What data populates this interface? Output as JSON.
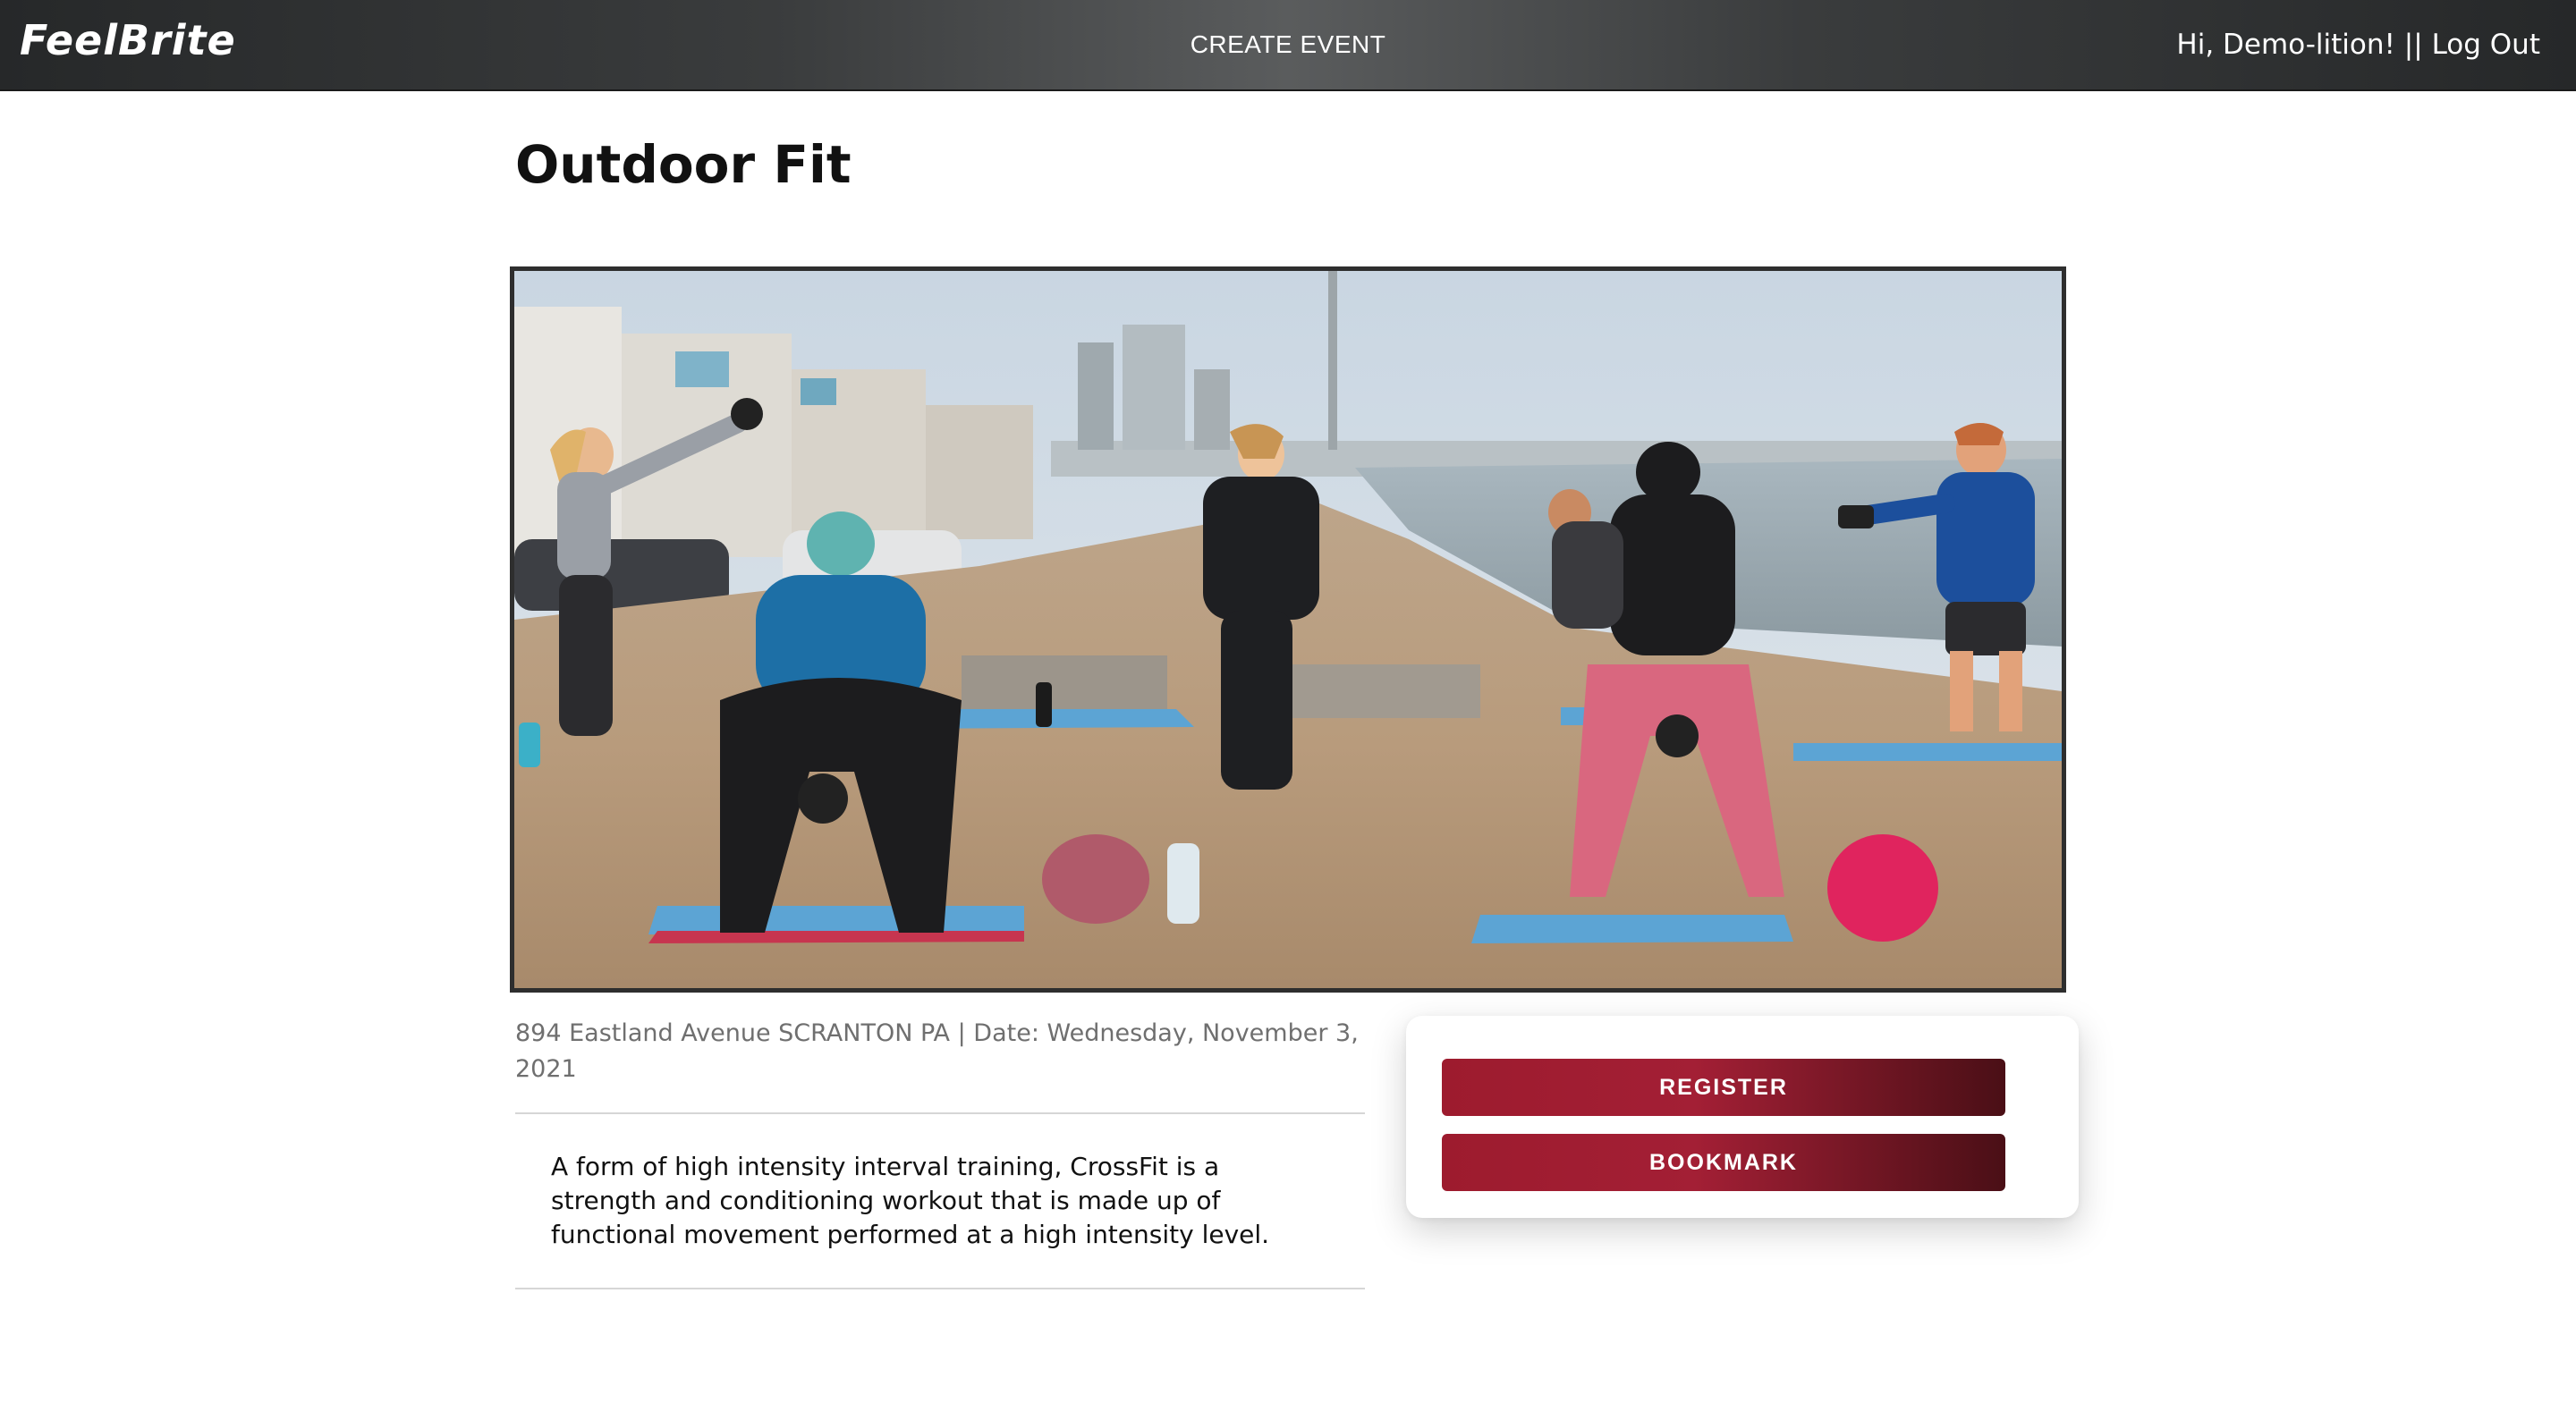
{
  "nav": {
    "logo": "FeelBrite",
    "create_event": "CREATE EVENT",
    "greeting": "Hi, Demo-lition! ||",
    "logout": "Log Out"
  },
  "event": {
    "title": "Outdoor Fit",
    "meta": "894 Eastland Avenue SCRANTON PA | Date: Wednesday, November 3, 2021",
    "description": "A form of high intensity interval training, CrossFit is a strength and conditioning workout that is made up of functional movement performed at a high intensity level."
  },
  "actions": {
    "register": "REGISTER",
    "bookmark": "BOOKMARK"
  },
  "colors": {
    "navbar": "#3a3c3d",
    "button_primary": "#a31f35",
    "button_dark": "#4a0f16"
  }
}
